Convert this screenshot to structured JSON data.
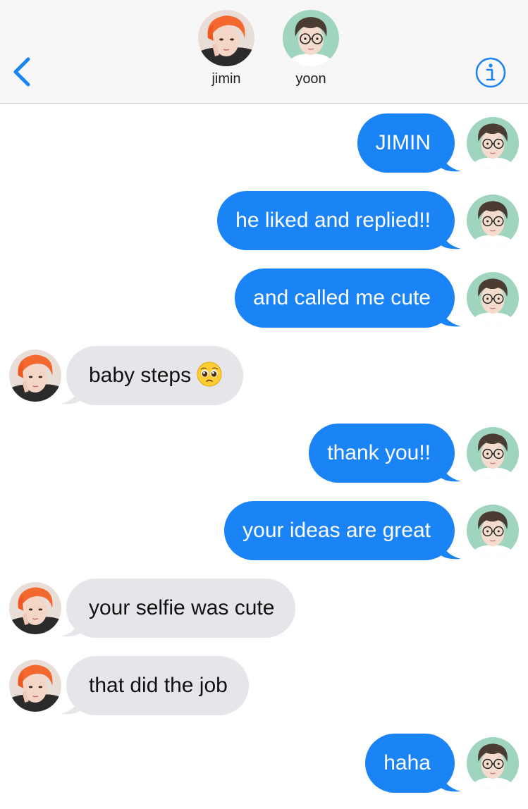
{
  "header": {
    "back_icon": "chevron-left-icon",
    "info_icon": "info-icon",
    "accent_color": "#1a83f5",
    "contacts": [
      {
        "name": "jimin",
        "avatar": "orange-hair-portrait"
      },
      {
        "name": "yoon",
        "avatar": "glasses-portrait"
      }
    ]
  },
  "messages": [
    {
      "direction": "sent",
      "text": "JIMIN"
    },
    {
      "direction": "sent",
      "text": "he liked and replied!!"
    },
    {
      "direction": "sent",
      "text": "and called me cute"
    },
    {
      "direction": "received",
      "text": "baby steps",
      "emoji": "pleading-face-emoji"
    },
    {
      "direction": "sent",
      "text": "thank you!!"
    },
    {
      "direction": "sent",
      "text": "your ideas are great"
    },
    {
      "direction": "received",
      "text": "your selfie was cute"
    },
    {
      "direction": "received",
      "text": "that did the job"
    },
    {
      "direction": "sent",
      "text": "haha"
    }
  ],
  "colors": {
    "sent_bubble": "#1a83f5",
    "received_bubble": "#e5e5ea",
    "header_bg": "#f7f7f7"
  }
}
